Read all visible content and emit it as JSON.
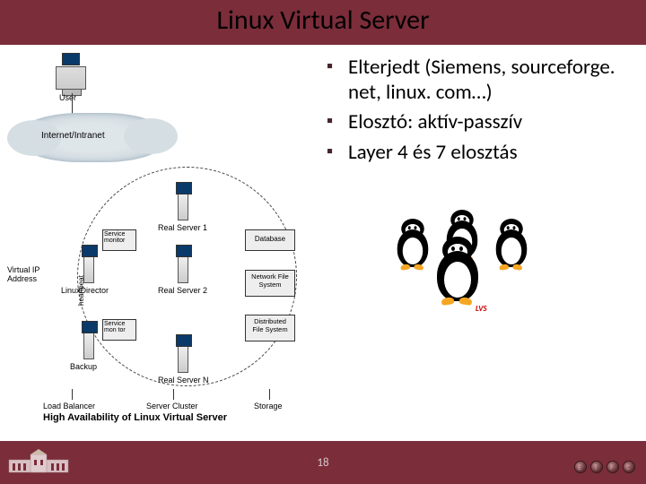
{
  "title": "Linux Virtual Server",
  "bullets": [
    "Elterjedt (Siemens, sourceforge. net, linux. com…)",
    "Elosztó: aktív-passzív",
    "Layer 4 és 7 elosztás"
  ],
  "page_number": "18",
  "diagram": {
    "user": "User",
    "cloud": "Internet/Intranet",
    "virtual_ip": "Virtual IP Address",
    "linux_director": "LinuxDirector",
    "heartbeat": "heartbeat",
    "backup": "Backup",
    "service_monitor_1": "Service monitor",
    "service_monitor_2": "Service mon tor",
    "real_server_1": "Real Server 1",
    "real_server_2": "Real Server 2",
    "real_server_n": "Real Server N",
    "database": "Database",
    "nfs": "Network File System",
    "dfs": "Distributed File System",
    "load_balancer": "Load Balancer",
    "server_cluster": "Server Cluster",
    "storage": "Storage",
    "caption": "High Availability of Linux Virtual Server"
  },
  "penguin_label": "LVS",
  "footer_icons": [
    "E",
    "T",
    "F",
    "C"
  ]
}
